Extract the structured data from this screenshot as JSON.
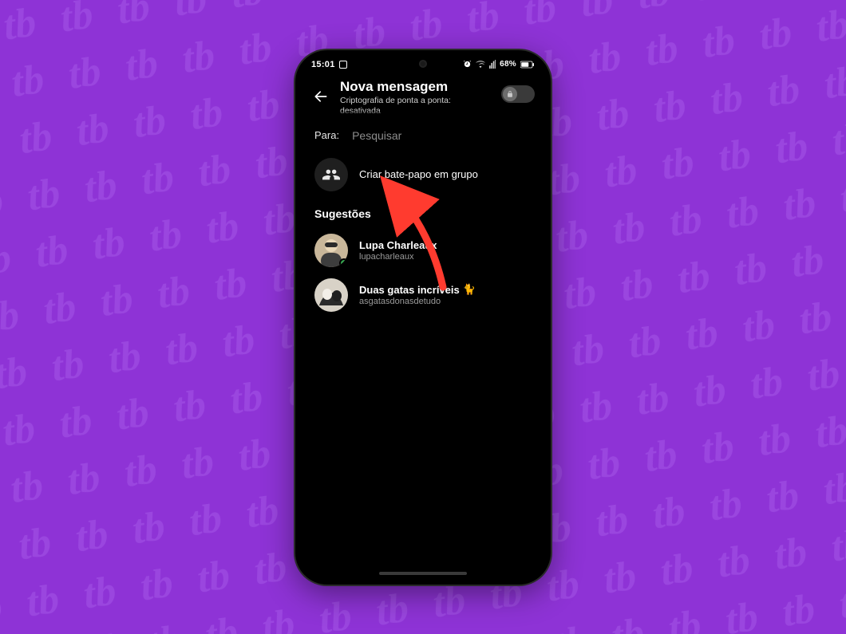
{
  "status_bar": {
    "time": "15:01",
    "battery_text": "68%"
  },
  "header": {
    "title": "Nova mensagem",
    "subtitle_line1": "Criptografia de ponta a ponta:",
    "subtitle_line2": "desativada"
  },
  "search": {
    "label": "Para:",
    "placeholder": "Pesquisar"
  },
  "create_group": {
    "label": "Criar bate-papo em grupo"
  },
  "suggestions": {
    "heading": "Sugestões",
    "items": [
      {
        "name": "Lupa Charleaux",
        "username": "lupacharleaux",
        "online": true
      },
      {
        "name": "Duas gatas incríveis",
        "username": "asgatasdonasdetudo",
        "online": false,
        "badge": "🐈"
      }
    ]
  },
  "colors": {
    "page_bg": "#8e33d6",
    "pattern": "#9a46df",
    "arrow": "#ff3b2f",
    "presence": "#31a24c"
  }
}
